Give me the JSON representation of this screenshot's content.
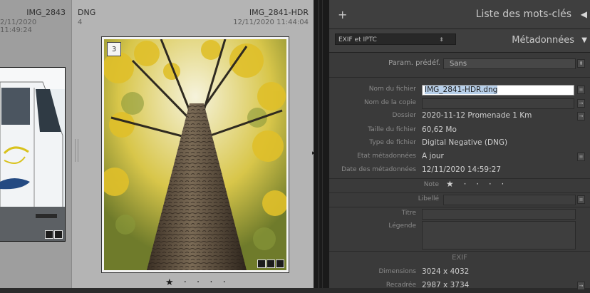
{
  "grid": {
    "cell_a": {
      "filename": "IMG_2843",
      "date": "2/11/2020 11:49:24"
    },
    "cell_b": {
      "extension": "DNG",
      "count": "4",
      "filename": "IMG_2841-HDR",
      "date": "12/11/2020 11:44:04",
      "badge_number": "3",
      "rating": "★ · · · ·"
    }
  },
  "panel": {
    "keywords_title": "Liste des mots-clés",
    "metadata_preset_select": "EXIF et IPTC",
    "metadata_title": "Métadonnées",
    "preset": {
      "label": "Param. prédéf.",
      "value": "Sans"
    },
    "fields": {
      "filename": {
        "label": "Nom du fichier",
        "value": "IMG_2841-HDR.dng"
      },
      "copy_name": {
        "label": "Nom de la copie",
        "value": ""
      },
      "folder": {
        "label": "Dossier",
        "value": "2020-11-12 Promenade 1 Km"
      },
      "file_size": {
        "label": "Taille du fichier",
        "value": "60,62 Mo"
      },
      "file_type": {
        "label": "Type de fichier",
        "value": "Digital Negative (DNG)"
      },
      "metadata_status": {
        "label": "Etat métadonnées",
        "value": "A jour"
      },
      "metadata_date": {
        "label": "Date des métadonnées",
        "value": "12/11/2020 14:59:27"
      },
      "rating": {
        "label": "Note",
        "value": "★ · · · ·"
      },
      "label": {
        "label": "Libellé",
        "value": ""
      },
      "title": {
        "label": "Titre",
        "value": ""
      },
      "caption": {
        "label": "Légende",
        "value": ""
      }
    },
    "exif": {
      "section_title": "EXIF",
      "dimensions": {
        "label": "Dimensions",
        "value": "3024 x 4032"
      },
      "cropped": {
        "label": "Recadrée",
        "value": "2987 x 3734"
      }
    }
  },
  "colors": {
    "grid_bg": "#b4b4b4",
    "panel_bg": "#3a3a3a",
    "selection": "#b8d0ea"
  }
}
